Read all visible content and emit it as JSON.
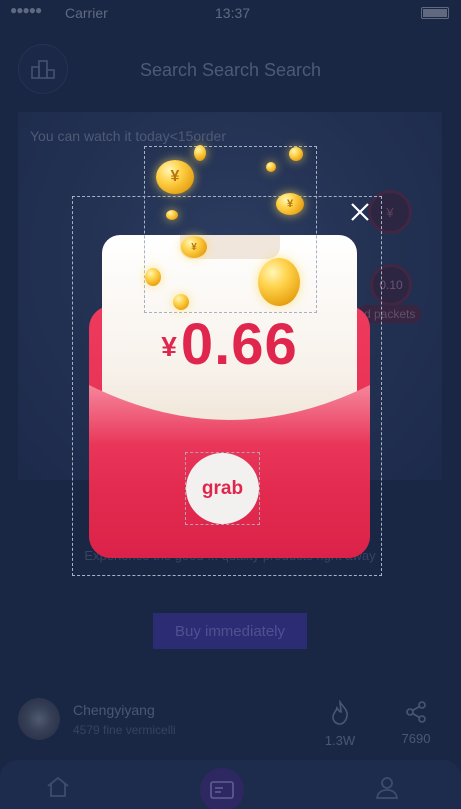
{
  "status_bar": {
    "signal": "●●●●●",
    "carrier": "Carrier",
    "time": "13:37"
  },
  "header": {
    "title": "Search Search Search"
  },
  "video": {
    "watch_text": "You can watch it today<15order",
    "coin_badge": "¥",
    "amount_badge": "0.10",
    "packets_label": "d packets"
  },
  "description": "Experience the good ... quality products right away",
  "buy_button": "Buy immediately",
  "author": {
    "name": "Chengyiyang",
    "subtitle": "4579 fine vermicelli",
    "fire_count": "1.3W",
    "share_count": "7690"
  },
  "red_packet": {
    "currency": "¥",
    "amount": "0.66",
    "grab_label": "grab"
  },
  "colors": {
    "accent_red": "#e0264d",
    "background": "#1d2d4e",
    "buy_button": "#3a3596"
  },
  "icons": {
    "rank": "ranking-icon",
    "close": "close-icon",
    "fire": "fire-icon",
    "share": "share-icon",
    "home": "home-icon",
    "center": "id-card-icon",
    "profile": "user-icon"
  }
}
